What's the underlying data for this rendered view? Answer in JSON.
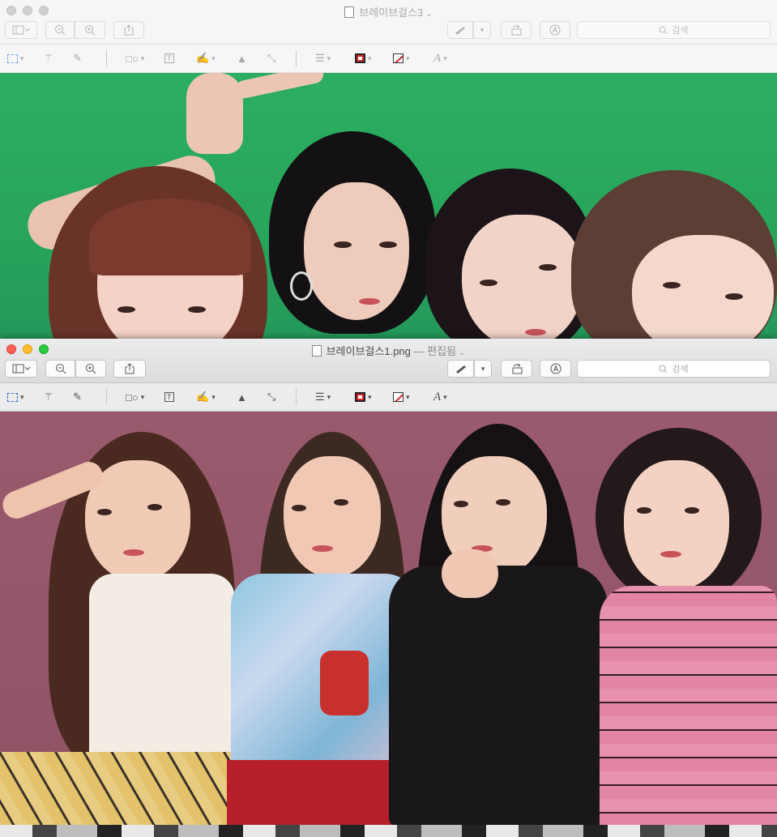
{
  "back_window": {
    "title": "브레이브걸스3",
    "search_placeholder": "검색"
  },
  "front_window": {
    "title": "브레이브걸스1.png",
    "title_suffix": "— 편집됨",
    "search_placeholder": "검색"
  },
  "icons": {
    "sidebar": "sidebar-icon",
    "zoom_out": "zoom-out-icon",
    "zoom_in": "zoom-in-icon",
    "share": "share-icon",
    "markup_pen": "pen-icon",
    "rotate": "rotate-icon",
    "annotate": "markup-circle-icon",
    "search": "search-icon"
  },
  "colors": {
    "border_color": "#d8262a",
    "fill_slash": "#e0282c",
    "photo1_bg": "#2cae62",
    "photo2_bg": "#9a5a6e"
  }
}
